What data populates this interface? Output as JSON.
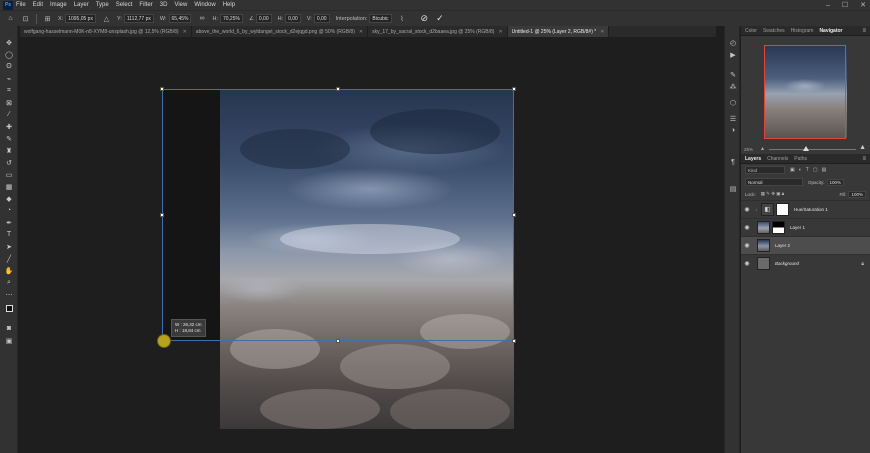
{
  "menu": {
    "logo": "Ps",
    "items": [
      "File",
      "Edit",
      "Image",
      "Layer",
      "Type",
      "Select",
      "Filter",
      "3D",
      "View",
      "Window",
      "Help"
    ],
    "window_controls": [
      "–",
      "☐",
      "✕"
    ]
  },
  "options": {
    "x_label": "X:",
    "x_value": "1095,05 px",
    "y_label": "Y:",
    "y_value": "1112,77 px",
    "w_label": "W:",
    "w_value": "65,45%",
    "h_label": "H:",
    "h_value": "70,25%",
    "angle_label": "∠",
    "angle_value": "0,00",
    "hskew_label": "H:",
    "hskew_value": "0,00",
    "vskew_label": "V:",
    "vskew_value": "0,00",
    "interp_label": "Interpolation:",
    "interp_value": "Bicubic"
  },
  "tabs": [
    {
      "label": "wolfgang-hasselmann-M0K-n8-XYM8-unsplash.jpg @ 12,5% (RGB/8)",
      "active": false
    },
    {
      "label": "above_the_world_6_by_wyldangel_stock_d2ejqgd.png @ 50% (RGB/8)",
      "active": false
    },
    {
      "label": "sky_17_by_sacral_stock_d2baaea.jpg @ 25% (RGB/8)",
      "active": false
    },
    {
      "label": "Untitled-1 @ 25% (Layer 2, RGB/8#) *",
      "active": true
    }
  ],
  "transform_tooltip": {
    "w": "W : 26,32 cm",
    "h": "H : 18,84 cm"
  },
  "top_panel": {
    "tabs": [
      "Color",
      "Swatches",
      "Histogram",
      "Navigator"
    ],
    "active": "Navigator",
    "zoom": "25%"
  },
  "layers_panel": {
    "tabs": [
      "Layers",
      "Channels",
      "Paths"
    ],
    "active": "Layers",
    "kind_filter": "Kind",
    "blend_mode": "Normal",
    "opacity_label": "Opacity:",
    "opacity_value": "100%",
    "lock_label": "Lock:",
    "fill_label": "Fill:",
    "fill_value": "100%",
    "layers": [
      {
        "name": "Hue/Saturation 1",
        "selected": false,
        "italic": false
      },
      {
        "name": "Layer 1",
        "selected": false,
        "italic": false
      },
      {
        "name": "Layer 2",
        "selected": true,
        "italic": false
      },
      {
        "name": "Background",
        "selected": false,
        "italic": true
      }
    ]
  },
  "colors": {
    "accent_blue": "#3f6fb0",
    "navigator_red": "#e0453a",
    "cursor_yellow": "#b7a21d"
  }
}
